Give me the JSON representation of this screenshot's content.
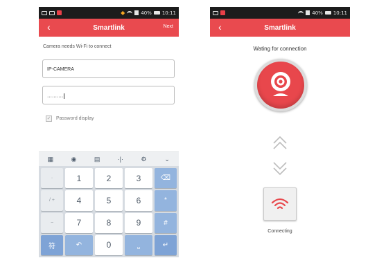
{
  "screen1": {
    "status": {
      "time": "10:11",
      "battery": "40%"
    },
    "appbar": {
      "back": "‹",
      "title": "Smartlink",
      "next": "Next"
    },
    "hint": "Camera needs Wi-Fi to connect",
    "ssid_value": "IP-CAMERA",
    "password_value": "··········",
    "password_display_label": "Password display",
    "password_display_checked": true,
    "keyboard": {
      "toolbar": [
        "▦",
        "◉",
        "▤",
        "·|·",
        "⚙",
        "⌄"
      ],
      "rows": [
        {
          "side": "·",
          "keys": [
            "1",
            "2",
            "3"
          ],
          "fn": "⌫"
        },
        {
          "side": "/",
          "keys": [
            "4",
            "5",
            "6"
          ],
          "fn": "*"
        },
        {
          "side": "−",
          "keys": [
            "7",
            "8",
            "9"
          ],
          "fn": "#"
        },
        {
          "side": "符",
          "keys": [
            "↶",
            "0",
            "⎵"
          ],
          "fn": "↵"
        }
      ],
      "side_extra": "+"
    }
  },
  "screen2": {
    "status": {
      "time": "10:11",
      "battery": "40%"
    },
    "appbar": {
      "back": "‹",
      "title": "Smartlink"
    },
    "waiting_text": "Wating for connection",
    "connecting_text": "Connecting"
  },
  "colors": {
    "brand_red": "#e94a4f",
    "key_blue": "#93b4de",
    "status_bar": "#1c1c1c"
  }
}
